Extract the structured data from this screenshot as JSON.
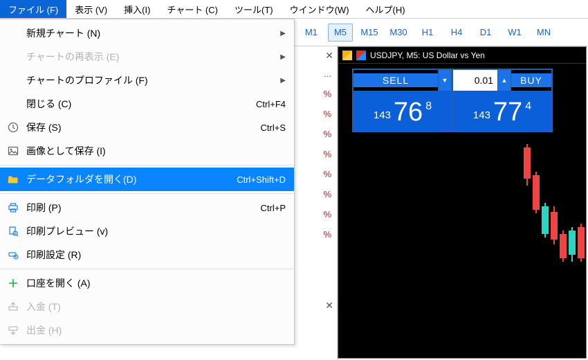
{
  "menubar": {
    "file": "ファイル (F)",
    "view": "表示 (V)",
    "insert": "挿入(I)",
    "chart": "チャート (C)",
    "tools": "ツール(T)",
    "window": "ウインドウ(W)",
    "help": "ヘルプ(H)"
  },
  "file_menu": {
    "new_chart": "新規チャート (N)",
    "reopen_chart": "チャートの再表示 (E)",
    "chart_profile": "チャートのプロファイル (F)",
    "close": "閉じる (C)",
    "close_sc": "Ctrl+F4",
    "save": "保存 (S)",
    "save_sc": "Ctrl+S",
    "save_image": "画像として保存 (I)",
    "open_data_folder": "データフォルダを開く(D)",
    "open_data_folder_sc": "Ctrl+Shift+D",
    "print": "印刷 (P)",
    "print_sc": "Ctrl+P",
    "print_preview": "印刷プレビュー (v)",
    "print_setup": "印刷設定 (R)",
    "open_account": "口座を開く (A)",
    "deposit": "入金 (T)",
    "withdraw": "出金 (H)",
    "submenu_arrow": "▶"
  },
  "timeframes": {
    "m1": "M1",
    "m5": "M5",
    "m15": "M15",
    "m30": "M30",
    "h1": "H1",
    "h4": "H4",
    "d1": "D1",
    "w1": "W1",
    "mn": "MN"
  },
  "watch": {
    "close": "✕",
    "dots": "...",
    "pct": "%"
  },
  "chart": {
    "title": "USDJPY, M5:  US Dollar vs Yen",
    "sell": "SELL",
    "buy": "BUY",
    "down": "▼",
    "up": "▲",
    "lot": "0.01",
    "bid_h": "143",
    "bid_big": "76",
    "bid_tick": "8",
    "ask_h": "143",
    "ask_big": "77",
    "ask_tick": "4"
  }
}
